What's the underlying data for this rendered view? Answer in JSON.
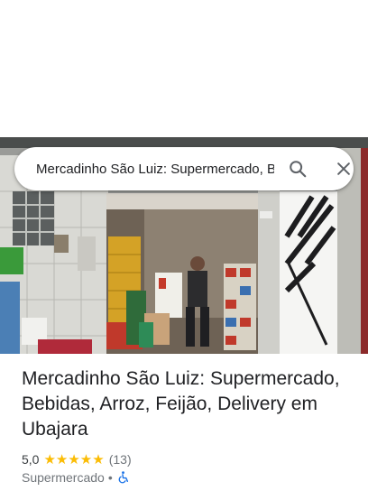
{
  "search": {
    "value": "Mercadinho São Luiz: Supermercado, Bebidas, Arroz, Feijão, Delivery em Ubajara"
  },
  "place": {
    "title": "Mercadinho São Luiz: Supermercado, Bebidas, Arroz, Feijão, Delivery em Ubajara",
    "rating": "5,0",
    "stars": "★★★★★",
    "review_count": "(13)",
    "category": "Supermercado",
    "separator": "•"
  },
  "colors": {
    "star": "#fbbc04",
    "accessibility_icon": "#1a73e8",
    "title_text": "#202124",
    "secondary_text": "#70757a"
  },
  "icons": {
    "search": "search-icon",
    "close": "close-icon",
    "accessibility": "wheelchair-accessible-icon"
  }
}
